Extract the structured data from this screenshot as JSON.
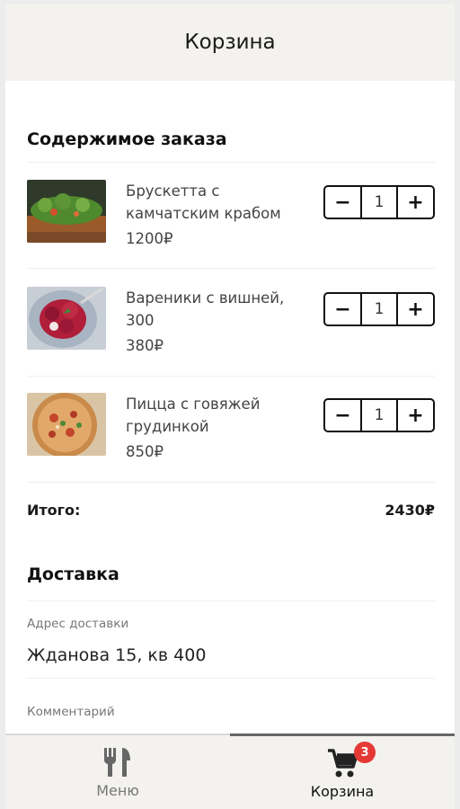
{
  "header": {
    "title": "Корзина"
  },
  "order": {
    "section_title": "Содержимое заказа",
    "items": [
      {
        "name": "Брускетта с камчатским крабом",
        "price": "1200₽",
        "quantity": "1",
        "image": "bruschetta-photo"
      },
      {
        "name": "Вареники с вишней, 300",
        "price": "380₽",
        "quantity": "1",
        "image": "vareniki-photo"
      },
      {
        "name": "Пицца с говяжей грудинкой",
        "price": "850₽",
        "quantity": "1",
        "image": "pizza-photo"
      }
    ],
    "decrement_symbol": "−",
    "increment_symbol": "+",
    "total_label": "Итого:",
    "total_value": "2430₽"
  },
  "delivery": {
    "section_title": "Доставка",
    "address_label": "Адрес доставки",
    "address_value": "Жданова 15, кв 400",
    "comment_label": "Комментарий"
  },
  "tabbar": {
    "tabs": [
      {
        "label": "Меню",
        "icon": "fork-knife-icon",
        "active": false
      },
      {
        "label": "Корзина",
        "icon": "cart-icon",
        "active": true
      }
    ],
    "cart_badge": "3",
    "colors": {
      "badge": "#e53935",
      "inactive": "#777777",
      "active": "#111111"
    }
  }
}
